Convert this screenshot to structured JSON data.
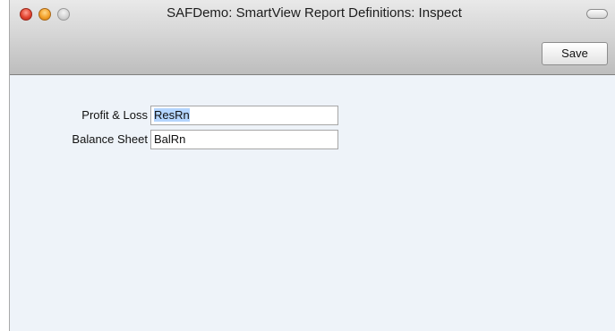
{
  "window": {
    "title": "SAFDemo: SmartView Report Definitions: Inspect"
  },
  "toolbar": {
    "save_label": "Save"
  },
  "form": {
    "fields": [
      {
        "label": "Profit & Loss",
        "value": "ResRn",
        "selected": true
      },
      {
        "label": "Balance Sheet",
        "value": "BalRn",
        "selected": false
      }
    ]
  },
  "colors": {
    "content_background": "#eef3f9",
    "selection_highlight": "#b4d5fe",
    "close_button": "#e2442f",
    "minimize_button": "#f3a12a"
  }
}
